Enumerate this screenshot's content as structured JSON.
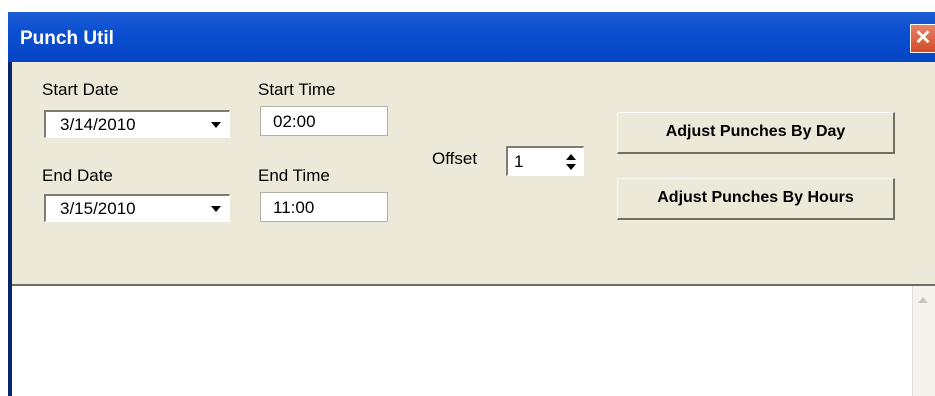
{
  "window": {
    "title": "Punch Util",
    "close_label": "✕"
  },
  "form": {
    "start_date_label": "Start Date",
    "start_date_value": "3/14/2010",
    "end_date_label": "End Date",
    "end_date_value": "3/15/2010",
    "start_time_label": "Start Time",
    "start_time_value": "02:00",
    "end_time_label": "End Time",
    "end_time_value": "11:00",
    "offset_label": "Offset",
    "offset_value": "1"
  },
  "buttons": {
    "adjust_by_day": "Adjust Punches By Day",
    "adjust_by_hours": "Adjust Punches By Hours"
  },
  "icons": {
    "close": "close-icon",
    "dropdown": "chevron-down-icon",
    "spinner": "spinner-arrows-icon",
    "scroll_up": "scroll-up-icon"
  },
  "colors": {
    "titlebar": "#0b4fd0",
    "client_bg": "#ece9d8",
    "close_btn": "#d24a25"
  }
}
